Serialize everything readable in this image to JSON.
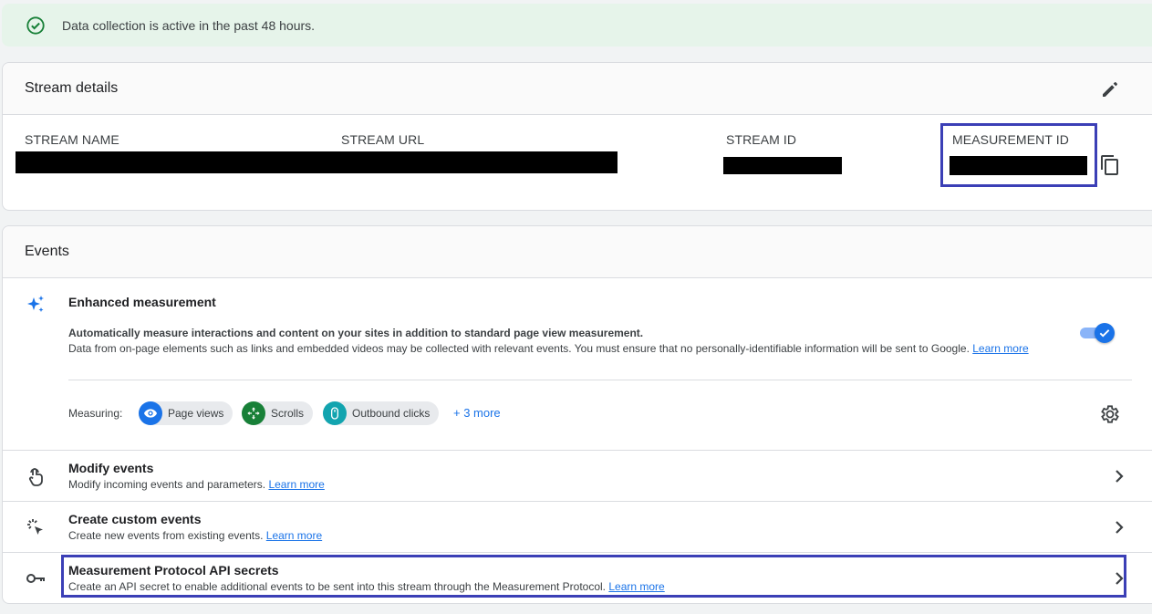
{
  "banner": {
    "text": "Data collection is active in the past 48 hours."
  },
  "stream_details": {
    "title": "Stream details",
    "columns": [
      {
        "label": "STREAM NAME"
      },
      {
        "label": "STREAM URL"
      },
      {
        "label": "STREAM ID"
      },
      {
        "label": "MEASUREMENT ID"
      }
    ]
  },
  "events": {
    "title": "Events",
    "enhanced": {
      "title": "Enhanced measurement",
      "desc_bold": "Automatically measure interactions and content on your sites in addition to standard page view measurement.",
      "desc": "Data from on-page elements such as links and embedded videos may be collected with relevant events. You must ensure that no personally-identifiable information will be sent to Google.",
      "learn_more": "Learn more",
      "enabled": true,
      "measuring_label": "Measuring:",
      "chips": [
        {
          "label": "Page views",
          "icon": "eye-icon",
          "color": "#1a73e8"
        },
        {
          "label": "Scrolls",
          "icon": "scroll-icon",
          "color": "#188038"
        },
        {
          "label": "Outbound clicks",
          "icon": "mouse-icon",
          "color": "#12a4af"
        }
      ],
      "more": "+ 3 more"
    },
    "rows": [
      {
        "title": "Modify events",
        "desc": "Modify incoming events and parameters.",
        "learn_more": "Learn more"
      },
      {
        "title": "Create custom events",
        "desc": "Create new events from existing events.",
        "learn_more": "Learn more"
      },
      {
        "title": "Measurement Protocol API secrets",
        "desc": "Create an API secret to enable additional events to be sent into this stream through the Measurement Protocol.",
        "learn_more": "Learn more"
      }
    ]
  },
  "colors": {
    "accent": "#1a73e8",
    "success": "#188038",
    "highlight": "#3b3fb6"
  }
}
